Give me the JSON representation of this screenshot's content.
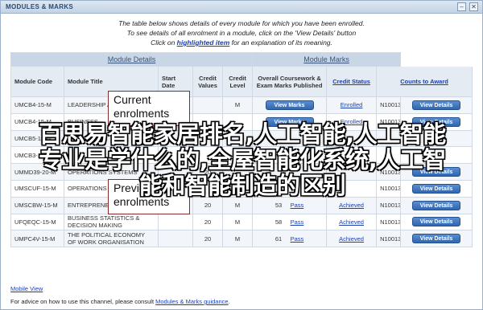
{
  "window": {
    "title": "MODULES & MARKS",
    "min_btn": "–",
    "close_btn": "✕"
  },
  "instructions": {
    "line1": "The table below shows details of every module for which you have been enrolled.",
    "line2": "To see details of all enrolment in a module, click on the 'View Details' button",
    "line3_pre": "Click on ",
    "line3_link": "highlighted item",
    "line3_post": " for an explanation of its meaning."
  },
  "table": {
    "group_headers": {
      "module_details": "Module Details",
      "module_marks": "Module Marks"
    },
    "columns": {
      "code": "Module Code",
      "title": "Module Title",
      "start": "Start Date",
      "credit_values": "Credit Values",
      "credit_level": "Credit Level",
      "marks_published": "Overall Coursework & Exam Marks Published",
      "credit_status": "Credit Status",
      "counts_to_award": "Counts to Award"
    },
    "rows": [
      {
        "code": "UMCB4-15-M",
        "title": "LEADERSHIP A",
        "start": "",
        "credits": "",
        "level": "M",
        "marks_btn": "View Marks",
        "status": "Enrolled",
        "award": "N10013",
        "details_btn": "View Details"
      },
      {
        "code": "UMCB4-15-M",
        "title": "BUSINESS",
        "start": "",
        "credits": "",
        "level": "",
        "marks_btn": "View Marks",
        "status": "Enrolled",
        "award": "N10013",
        "details_btn": "View Details"
      },
      {
        "code": "UMCB5-15-M",
        "title": "",
        "start": "",
        "credits": "",
        "level": "",
        "marks_btn": "",
        "status": "",
        "award": "",
        "details_btn": ""
      },
      {
        "code": "UMCB3-15-M",
        "title": "",
        "start": "",
        "credits": "",
        "level": "",
        "marks_btn": "",
        "status": "",
        "award": "",
        "details_btn": ""
      },
      {
        "code": "UMMD39-20-M",
        "title": "OPERATIONS SYSTEMS",
        "start": "",
        "credits": "20",
        "level": "",
        "marks_btn": "",
        "status": "",
        "award": "N10013",
        "details_btn": "View Details"
      },
      {
        "code": "UMSCUF-15-M",
        "title": "OPERATIONS",
        "start": "",
        "credits": "",
        "level": "",
        "marks_btn": "",
        "status": "",
        "award": "N10013",
        "details_btn": "View Details"
      },
      {
        "code": "UMSCBW-15-M",
        "title": "ENTREPRENEURSHIP & INNOVATION",
        "start": "",
        "credits": "20",
        "level": "M",
        "mark": "53",
        "result": "Pass",
        "status": "Achieved",
        "award": "N10013",
        "details_btn": "View Details"
      },
      {
        "code": "UFQEQC-15-M",
        "title": "BUSINESS STATISTICS & DECISION MAKING",
        "start": "",
        "credits": "20",
        "level": "M",
        "mark": "58",
        "result": "Pass",
        "status": "Achieved",
        "award": "N10013",
        "details_btn": "View Details"
      },
      {
        "code": "UMPC4V-15-M",
        "title": "THE POLITICAL ECONOMY OF WORK ORGANISATION",
        "start": "",
        "credits": "20",
        "level": "M",
        "mark": "61",
        "result": "Pass",
        "status": "Achieved",
        "award": "N10013",
        "details_btn": "View Details"
      }
    ]
  },
  "callouts": {
    "current": [
      "Current",
      "enrolments"
    ],
    "previous": [
      "Previous",
      "enrolments"
    ]
  },
  "overlay": {
    "line1": "百思易智能家居排名,人工智能,人工智能",
    "line2": "专业是学什么的,全屋智能化系统,人工智",
    "line3": "能和智能制造的区别"
  },
  "mobile_link": "Mobile View",
  "footer": {
    "pre": "For advice on how to use this channel, please consult ",
    "link": "Modules & Marks guidance",
    "post": "."
  }
}
